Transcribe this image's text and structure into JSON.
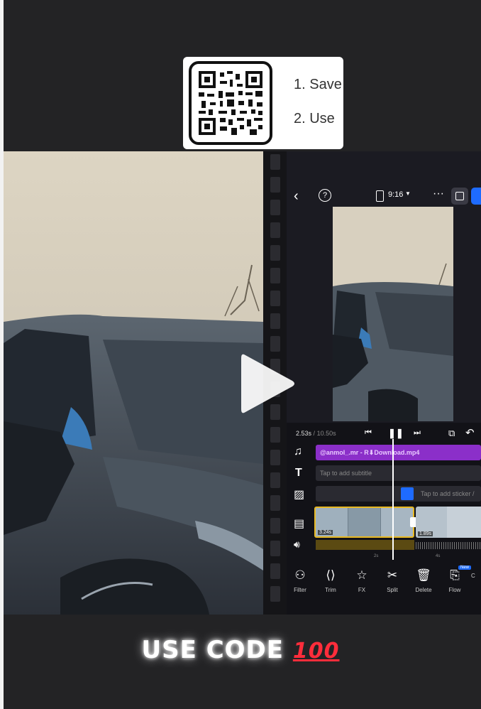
{
  "qr_card": {
    "step1": "1. Save",
    "step2": "2. Use"
  },
  "editor": {
    "aspect_ratio": "9:16",
    "time_current": "2.53s",
    "time_total": "10.50s",
    "audio_track": "@anmol_.mr - R⬇Download.mp4",
    "subtitle_placeholder": "Tap to add subtitle",
    "sticker_placeholder": "Tap to add sticker /",
    "clip1_duration": "3.24s",
    "clip2_duration": "1.89s",
    "ruler_mark1": "2s",
    "ruler_mark2": "4s",
    "tools": [
      "Filter",
      "Trim",
      "FX",
      "Split",
      "Delete",
      "Flow",
      "C"
    ],
    "new_badge": "New"
  },
  "banner": {
    "text": "USE CODE",
    "emoji": "100"
  },
  "colors": {
    "accent_blue": "#1e6bff",
    "audio_purple": "#8b2fc9",
    "clip_yellow": "#e8b923",
    "emoji_red": "#ff2d3b"
  }
}
